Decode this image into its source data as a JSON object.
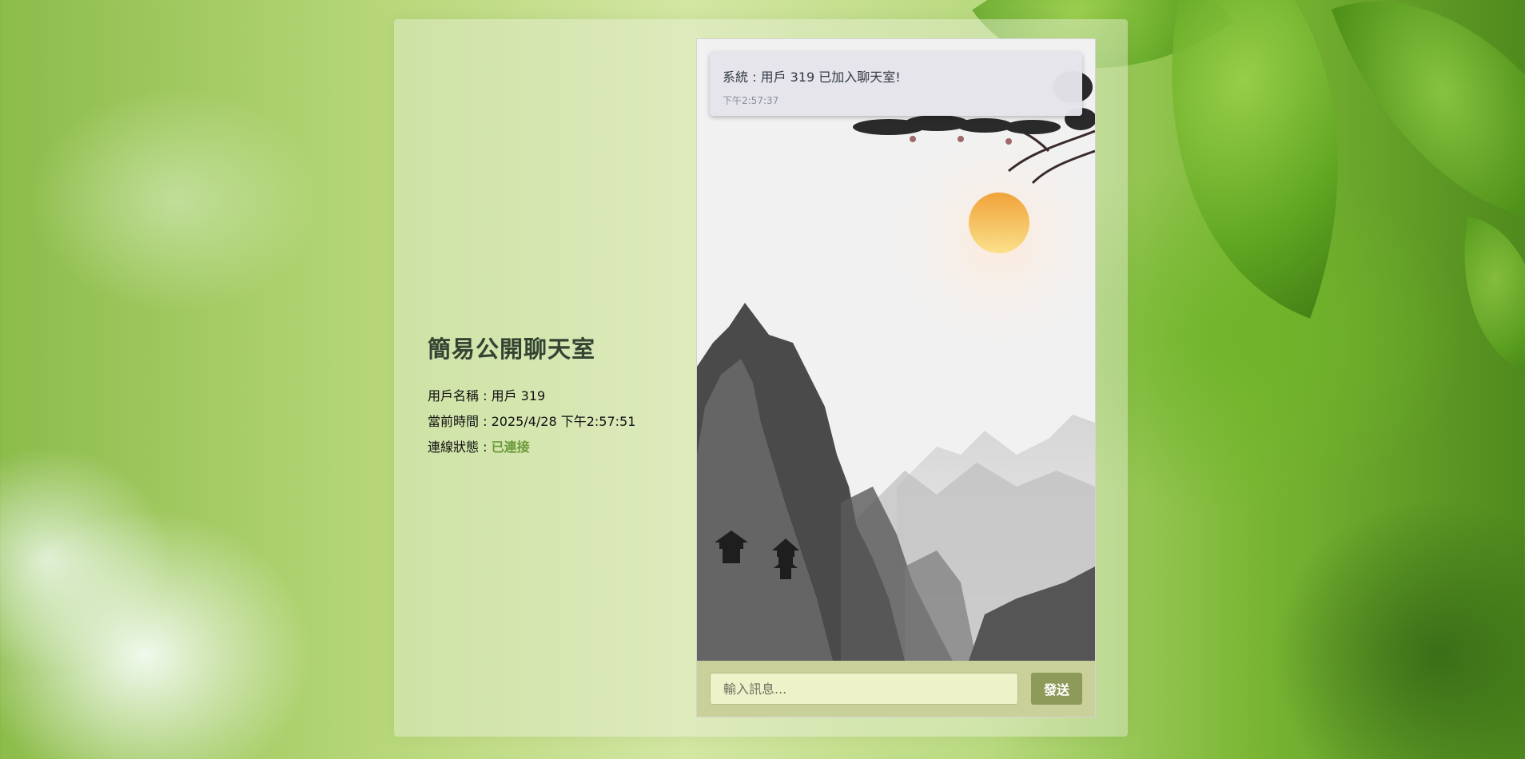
{
  "room": {
    "title": "簡易公開聊天室",
    "username_label": "用戶名稱 : ",
    "username": "用戶 319",
    "time_label": "當前時間 : ",
    "current_time": "2025/4/28 下午2:57:51",
    "status_label": "連線狀態 : ",
    "status": "已連接",
    "status_color": "#6b9a3a"
  },
  "chat": {
    "messages": [
      {
        "text": "系統 : 用戶 319 已加入聊天室!",
        "time": "下午2:57:37"
      }
    ],
    "input_placeholder": "輸入訊息...",
    "send_label": "發送"
  }
}
